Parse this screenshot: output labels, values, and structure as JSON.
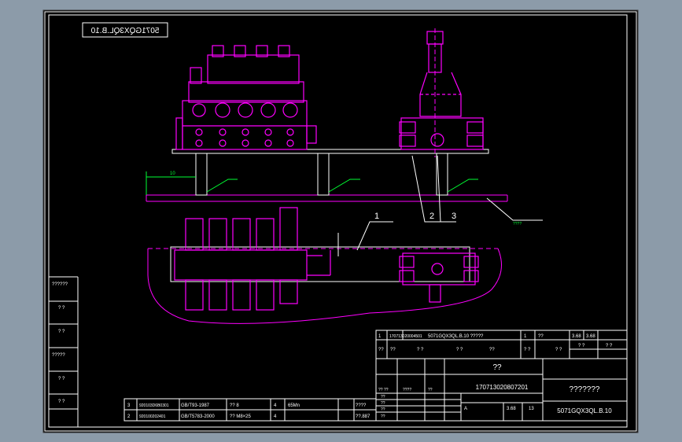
{
  "drawing": {
    "id_mirrored": "5071GQX3QL.B.10",
    "id_tail": "5071GQX3QL.B.10",
    "view_labels": [
      "1",
      "2",
      "3"
    ],
    "callout": "????",
    "tol": "10"
  },
  "left_column": [
    "??????",
    "? ?",
    "? ?",
    "?????",
    "? ?",
    "? ?"
  ],
  "bom": {
    "rows": [
      {
        "no": "3",
        "code": "920103D6B0301",
        "std": "GB/T93-1987",
        "name": "?? 8",
        "qty": "4",
        "mat": "65Mn",
        "note1": "????",
        "note2": ""
      },
      {
        "no": "2",
        "code": "920100202401",
        "std": "GB/T5783-2000",
        "name": "?? M8×25",
        "qty": "4",
        "mat": "",
        "note1": "",
        "note2": "??.887"
      }
    ]
  },
  "title_block": {
    "row1": [
      "1",
      "170713020004501",
      "5071GQX3QL.B.10 ?????",
      "1",
      "??",
      "3.68",
      "3.68"
    ],
    "row2": [
      "??",
      "??",
      "? ?",
      "? ?",
      "??",
      "? ?",
      "? ?",
      "? ?",
      "? ?"
    ],
    "name": "??",
    "drawing_no": "170713020807201",
    "company": "???????",
    "left_small": [
      "?? ??",
      "????",
      "??",
      "??",
      "??",
      "??",
      "??"
    ],
    "scale": "A",
    "weight": "3.68",
    "sheets": "13",
    "code_bottom": "5071GQX3QL.B.10"
  }
}
